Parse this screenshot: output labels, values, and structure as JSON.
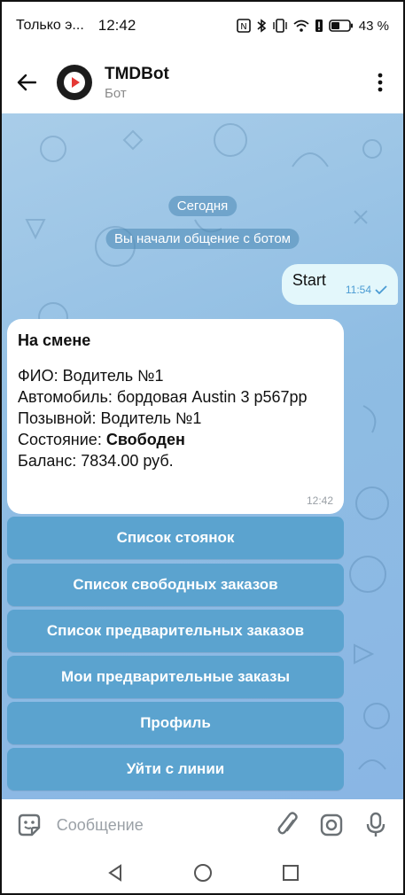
{
  "status_bar": {
    "carrier": "Только э...",
    "time": "12:42",
    "battery_percent": "43 %",
    "icons": [
      "nfc-icon",
      "bluetooth-icon",
      "vibrate-icon",
      "wifi-icon",
      "alert-icon",
      "battery-icon"
    ]
  },
  "header": {
    "title": "TMDBot",
    "subtitle": "Бот",
    "accent": "#e53935"
  },
  "chat": {
    "date_label": "Сегодня",
    "service_text": "Вы начали общение с ботом",
    "outgoing": {
      "text": "Start",
      "time": "11:54"
    },
    "incoming": {
      "title": "На смене",
      "line_fio": "ФИО: Водитель №1",
      "line_car": "Автомобиль: бордовая Austin 3 р567рр",
      "line_callsign": "Позывной: Водитель №1",
      "state_label": "Состояние: ",
      "state_value": "Свободен",
      "line_balance": "Баланс: 7834.00 руб.",
      "time": "12:42"
    },
    "keyboard": [
      "Список стоянок",
      "Список свободных заказов",
      "Список предварительных заказов",
      "Мои предварительные заказы",
      "Профиль",
      "Уйти с линии"
    ]
  },
  "input": {
    "placeholder": "Сообщение"
  },
  "colors": {
    "chat_bg": "#8fbde3",
    "button": "#5ba3cf",
    "outgoing_bubble": "#e3f7fb",
    "check": "#4a9bd3"
  }
}
